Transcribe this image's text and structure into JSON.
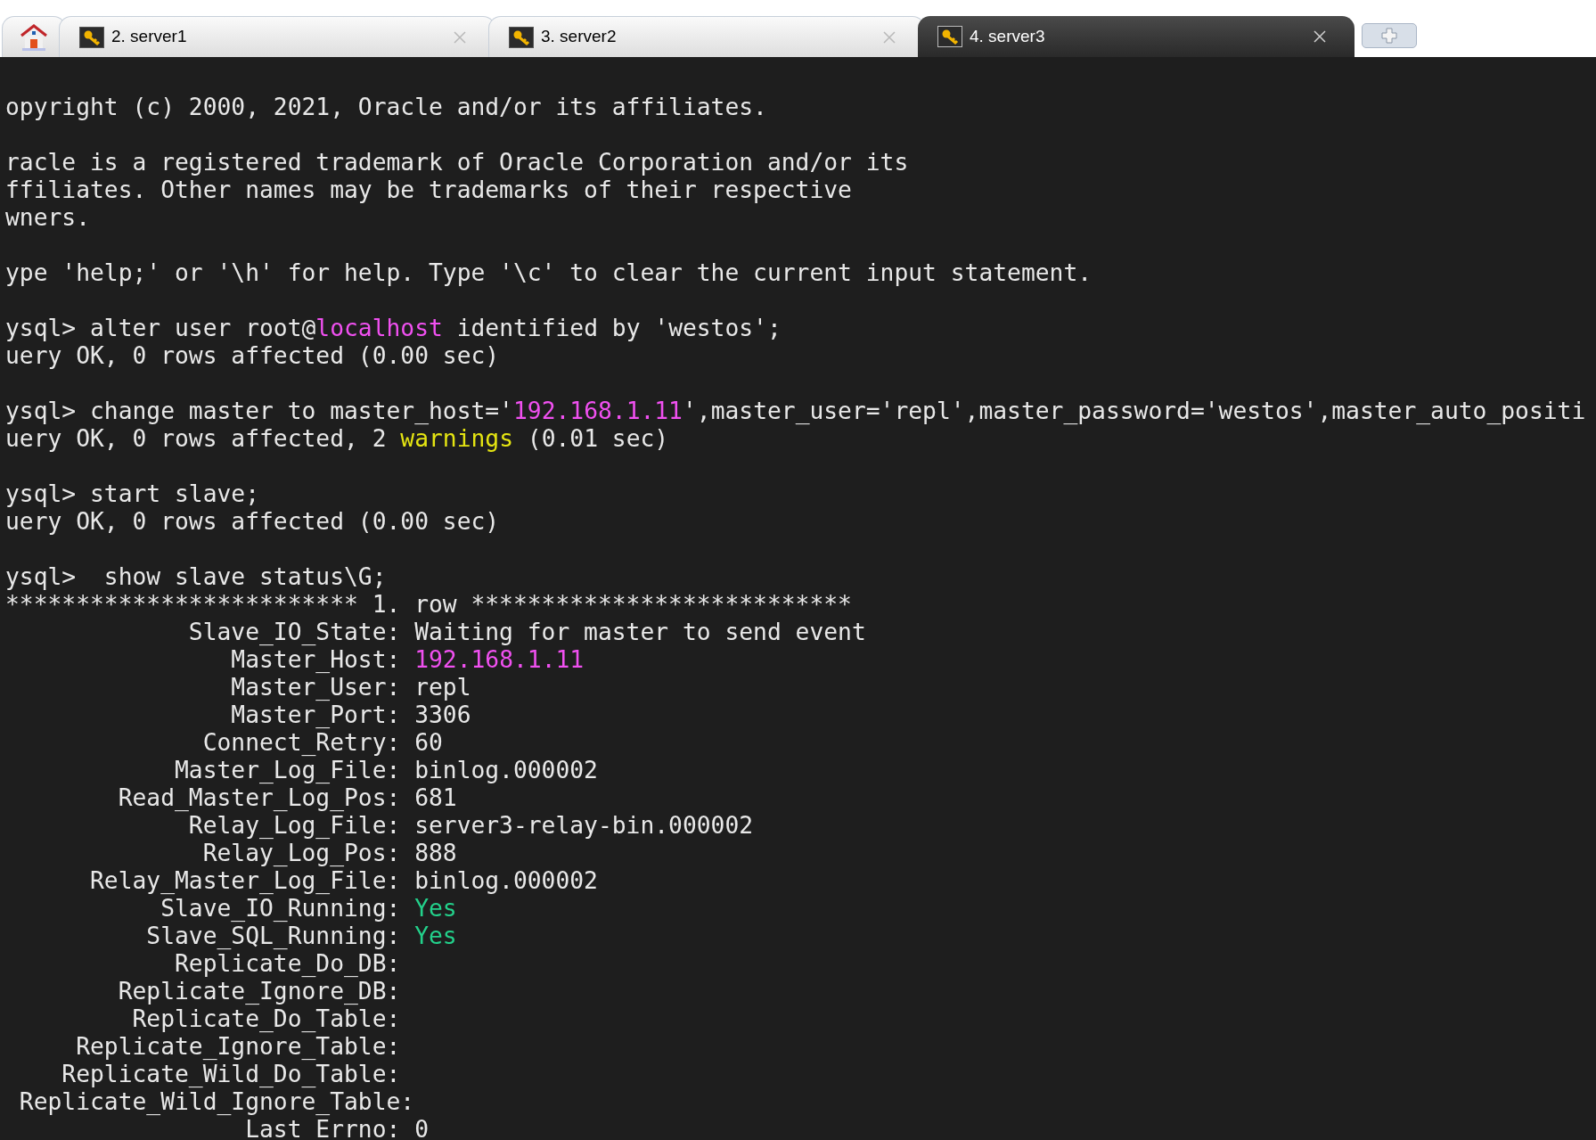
{
  "tabs": [
    {
      "kind": "home",
      "selected": false
    },
    {
      "kind": "session",
      "label": "2. server1",
      "selected": false
    },
    {
      "kind": "session",
      "label": "3. server2",
      "selected": false
    },
    {
      "kind": "session",
      "label": "4. server3",
      "selected": true
    },
    {
      "kind": "new"
    }
  ],
  "terminal": {
    "lines": [
      {
        "kind": "text",
        "segments": [
          {
            "kind": "plain",
            "text": "opyright (c) 2000, 2021, Oracle and/or its affiliates."
          }
        ]
      },
      {
        "kind": "blank"
      },
      {
        "kind": "text",
        "segments": [
          {
            "kind": "plain",
            "text": "racle is a registered trademark of Oracle Corporation and/or its"
          }
        ]
      },
      {
        "kind": "text",
        "segments": [
          {
            "kind": "plain",
            "text": "ffiliates. Other names may be trademarks of their respective"
          }
        ]
      },
      {
        "kind": "text",
        "segments": [
          {
            "kind": "plain",
            "text": "wners."
          }
        ]
      },
      {
        "kind": "blank"
      },
      {
        "kind": "text",
        "segments": [
          {
            "kind": "plain",
            "text": "ype 'help;' or '\\h' for help. Type '\\c' to clear the current input statement."
          }
        ]
      },
      {
        "kind": "blank"
      },
      {
        "kind": "text",
        "segments": [
          {
            "kind": "plain",
            "text": "ysql> alter user root@"
          },
          {
            "kind": "highlight",
            "text": "localhost"
          },
          {
            "kind": "plain",
            "text": " identified by 'westos';"
          }
        ]
      },
      {
        "kind": "text",
        "segments": [
          {
            "kind": "plain",
            "text": "uery OK, 0 rows affected (0.00 sec)"
          }
        ]
      },
      {
        "kind": "blank"
      },
      {
        "kind": "text",
        "segments": [
          {
            "kind": "plain",
            "text": "ysql> change master to master_host='"
          },
          {
            "kind": "highlight",
            "text": "192.168.1.11"
          },
          {
            "kind": "plain",
            "text": "',master_user='repl',master_password='westos',master_auto_positi"
          }
        ]
      },
      {
        "kind": "text",
        "segments": [
          {
            "kind": "plain",
            "text": "uery OK, 0 rows affected, 2 "
          },
          {
            "kind": "warning",
            "text": "warnings"
          },
          {
            "kind": "plain",
            "text": " (0.01 sec)"
          }
        ]
      },
      {
        "kind": "blank"
      },
      {
        "kind": "text",
        "segments": [
          {
            "kind": "plain",
            "text": "ysql> start slave;"
          }
        ]
      },
      {
        "kind": "text",
        "segments": [
          {
            "kind": "plain",
            "text": "uery OK, 0 rows affected (0.00 sec)"
          }
        ]
      },
      {
        "kind": "blank"
      },
      {
        "kind": "text",
        "segments": [
          {
            "kind": "plain",
            "text": "ysql>  show slave status\\G;"
          }
        ]
      },
      {
        "kind": "text",
        "segments": [
          {
            "kind": "plain",
            "text": "************************* 1. row ***************************"
          }
        ]
      },
      {
        "kind": "text",
        "segments": [
          {
            "kind": "plain",
            "text": "             Slave_IO_State: Waiting for master to send event"
          }
        ]
      },
      {
        "kind": "text",
        "segments": [
          {
            "kind": "plain",
            "text": "                Master_Host: "
          },
          {
            "kind": "highlight",
            "text": "192.168.1.11"
          }
        ]
      },
      {
        "kind": "text",
        "segments": [
          {
            "kind": "plain",
            "text": "                Master_User: repl"
          }
        ]
      },
      {
        "kind": "text",
        "segments": [
          {
            "kind": "plain",
            "text": "                Master_Port: 3306"
          }
        ]
      },
      {
        "kind": "text",
        "segments": [
          {
            "kind": "plain",
            "text": "              Connect_Retry: 60"
          }
        ]
      },
      {
        "kind": "text",
        "segments": [
          {
            "kind": "plain",
            "text": "            Master_Log_File: binlog.000002"
          }
        ]
      },
      {
        "kind": "text",
        "segments": [
          {
            "kind": "plain",
            "text": "        Read_Master_Log_Pos: 681"
          }
        ]
      },
      {
        "kind": "text",
        "segments": [
          {
            "kind": "plain",
            "text": "             Relay_Log_File: server3-relay-bin.000002"
          }
        ]
      },
      {
        "kind": "text",
        "segments": [
          {
            "kind": "plain",
            "text": "              Relay_Log_Pos: 888"
          }
        ]
      },
      {
        "kind": "text",
        "segments": [
          {
            "kind": "plain",
            "text": "      Relay_Master_Log_File: binlog.000002"
          }
        ]
      },
      {
        "kind": "text",
        "segments": [
          {
            "kind": "plain",
            "text": "           Slave_IO_Running: "
          },
          {
            "kind": "ok",
            "text": "Yes"
          }
        ]
      },
      {
        "kind": "text",
        "segments": [
          {
            "kind": "plain",
            "text": "          Slave_SQL_Running: "
          },
          {
            "kind": "ok",
            "text": "Yes"
          }
        ]
      },
      {
        "kind": "text",
        "segments": [
          {
            "kind": "plain",
            "text": "            Replicate_Do_DB:"
          }
        ]
      },
      {
        "kind": "text",
        "segments": [
          {
            "kind": "plain",
            "text": "        Replicate_Ignore_DB:"
          }
        ]
      },
      {
        "kind": "text",
        "segments": [
          {
            "kind": "plain",
            "text": "         Replicate_Do_Table:"
          }
        ]
      },
      {
        "kind": "text",
        "segments": [
          {
            "kind": "plain",
            "text": "     Replicate_Ignore_Table:"
          }
        ]
      },
      {
        "kind": "text",
        "segments": [
          {
            "kind": "plain",
            "text": "    Replicate_Wild_Do_Table:"
          }
        ]
      },
      {
        "kind": "text",
        "segments": [
          {
            "kind": "plain",
            "text": " Replicate_Wild_Ignore_Table:"
          }
        ]
      },
      {
        "kind": "text",
        "segments": [
          {
            "kind": "plain",
            "text": "                 Last_Errno: 0"
          }
        ]
      }
    ]
  }
}
